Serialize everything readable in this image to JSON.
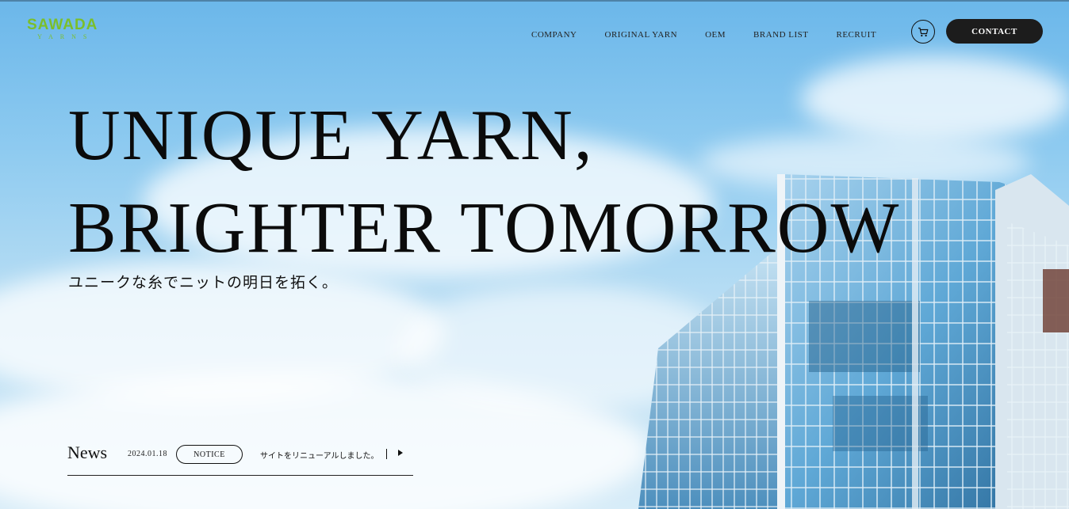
{
  "header": {
    "logo_main": "SAWADA",
    "logo_sub": "YARNS",
    "nav": [
      {
        "label": "COMPANY"
      },
      {
        "label": "ORIGINAL YARN"
      },
      {
        "label": "OEM"
      },
      {
        "label": "BRAND LIST"
      },
      {
        "label": "RECRUIT"
      }
    ],
    "cart_icon": "cart-icon",
    "contact_label": "CONTACT"
  },
  "hero": {
    "headline_line1": "UNIQUE YARN,",
    "headline_line2": "BRIGHTER TOMORROW",
    "subcopy": "ユニークな糸でニットの明日を拓く。"
  },
  "news": {
    "title": "News",
    "items": [
      {
        "date": "2024.01.18",
        "tag": "NOTICE",
        "text": "サイトをリニューアルしました。",
        "arrow_icon": "play-arrow-icon"
      }
    ]
  },
  "colors": {
    "logo": "#7bbf2a",
    "contact_bg": "#1c1c1c",
    "sky_top": "#6bb7ea",
    "sky_bottom": "#d7ecf8"
  }
}
